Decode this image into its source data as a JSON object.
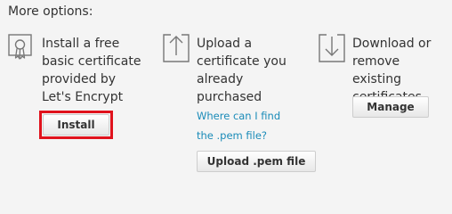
{
  "heading": "More options:",
  "options": [
    {
      "icon": "certificate-icon",
      "text_lines": [
        "Install a free",
        "basic certificate",
        "provided by",
        "Let's Encrypt"
      ],
      "button_label": "Install"
    },
    {
      "icon": "upload-icon",
      "text_lines": [
        "Upload a",
        "certificate you",
        "already",
        "purchased"
      ],
      "link_lines": [
        "Where can I find",
        "the .pem file?"
      ],
      "button_label": "Upload .pem file"
    },
    {
      "icon": "download-icon",
      "text_lines": [
        "Download or",
        "remove existing",
        "certificates"
      ],
      "button_label": "Manage"
    }
  ],
  "colors": {
    "background": "#f4f4f4",
    "text": "#333333",
    "link": "#1a8bb8",
    "icon": "#777777",
    "highlight": "#e0121c"
  }
}
